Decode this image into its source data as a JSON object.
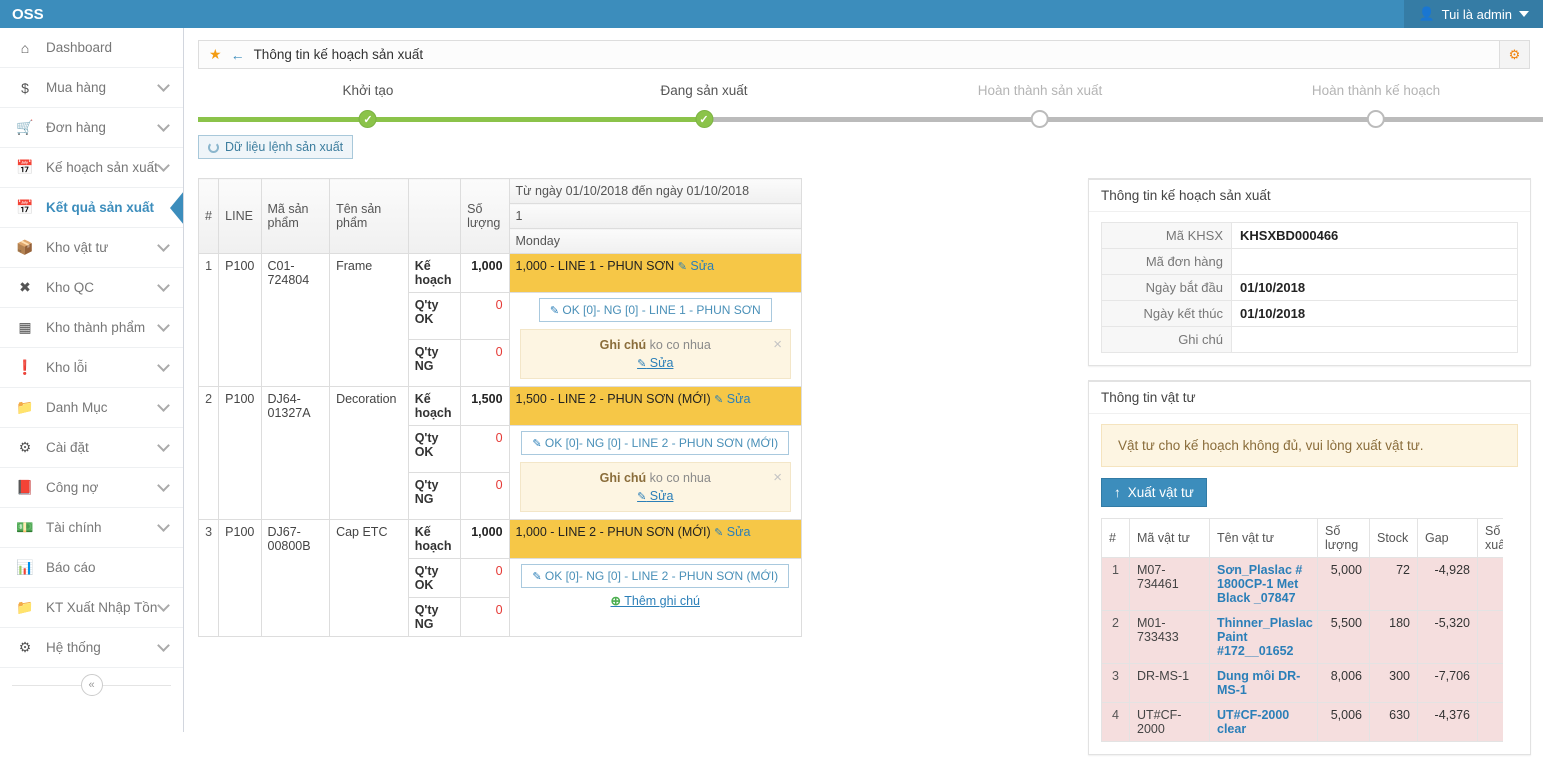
{
  "topbar": {
    "logo": "OSS",
    "user_label": "Tui là admin",
    "user_icon": "user-icon",
    "caret_icon": "caret-down-icon"
  },
  "sidebar": {
    "items": [
      {
        "label": "Dashboard",
        "icon": "home-icon",
        "caret": false,
        "active": false
      },
      {
        "label": "Mua hàng",
        "icon": "dollar-icon",
        "caret": true,
        "active": false
      },
      {
        "label": "Đơn hàng",
        "icon": "cart-icon",
        "caret": true,
        "active": false
      },
      {
        "label": "Kế hoạch sản xuất",
        "icon": "calendar-icon",
        "caret": true,
        "active": false
      },
      {
        "label": "Kết quả sản xuất",
        "icon": "calendar-icon",
        "caret": false,
        "active": true
      },
      {
        "label": "Kho vật tư",
        "icon": "box-icon",
        "caret": true,
        "active": false
      },
      {
        "label": "Kho QC",
        "icon": "qc-icon",
        "caret": true,
        "active": false
      },
      {
        "label": "Kho thành phẩm",
        "icon": "grid-icon",
        "caret": true,
        "active": false
      },
      {
        "label": "Kho lỗi",
        "icon": "exclamation-icon",
        "caret": true,
        "active": false
      },
      {
        "label": "Danh Mục",
        "icon": "folder-icon",
        "caret": true,
        "active": false
      },
      {
        "label": "Cài đặt",
        "icon": "gears-icon",
        "caret": true,
        "active": false
      },
      {
        "label": "Công nợ",
        "icon": "book-icon",
        "caret": true,
        "active": false
      },
      {
        "label": "Tài chính",
        "icon": "money-icon",
        "caret": true,
        "active": false
      },
      {
        "label": "Báo cáo",
        "icon": "bar-chart-icon",
        "caret": false,
        "active": false
      },
      {
        "label": "KT Xuất Nhập Tồn",
        "icon": "folder-icon",
        "caret": true,
        "active": false
      },
      {
        "label": "Hệ thống",
        "icon": "gear-icon",
        "caret": true,
        "active": false
      }
    ],
    "collapse_icon": "double-chevron-left-icon"
  },
  "page_header": {
    "star_icon": "star-icon",
    "back_icon": "arrow-left-icon",
    "title": "Thông tin kế hoạch sản xuất",
    "gear_icon": "gear-icon"
  },
  "stepper": {
    "steps": [
      {
        "label": "Khởi tạo",
        "state": "done"
      },
      {
        "label": "Đang sản xuất",
        "state": "done"
      },
      {
        "label": "Hoàn thành sản xuất",
        "state": "todo"
      },
      {
        "label": "Hoàn thành kế hoạch",
        "state": "todo"
      }
    ],
    "done_color": "#8bc34a",
    "todo_color": "#bbbbbb"
  },
  "subtoolbar": {
    "data_button": "Dữ liệu lệnh sản xuất",
    "data_button_icon": "circle-notch-icon"
  },
  "plan_table": {
    "headers": {
      "idx": "#",
      "line": "LINE",
      "product_code": "Mã sản phẩm",
      "product_name": "Tên sản phẩm",
      "kind": "",
      "qty": "Số lượng",
      "date_range": "Từ ngày 01/10/2018 đến ngày 01/10/2018",
      "day_number": "1",
      "day_name": "Monday"
    },
    "labels": {
      "ke_hoach": "Kế hoạch",
      "qty_ok": "Q'ty OK",
      "qty_ng": "Q'ty NG",
      "edit": "Sửa",
      "note_label": "Ghi chú",
      "add_note": "Thêm ghi chú",
      "close_icon": "close-icon",
      "pencil_icon": "pencil-icon",
      "plus_icon": "plus-circle-icon"
    },
    "rows": [
      {
        "idx": "1",
        "line": "P100",
        "product_code": "C01-724804",
        "product_name": "Frame",
        "plan_qty": "1,000",
        "ok_qty": "0",
        "ng_qty": "0",
        "plan_cell": "1,000 - LINE 1 - PHUN SƠN",
        "ok_button": "OK [0]- NG [0] - LINE 1 - PHUN SƠN",
        "note_text": "ko co nhua",
        "has_note": true
      },
      {
        "idx": "2",
        "line": "P100",
        "product_code": "DJ64-01327A",
        "product_name": "Decoration",
        "plan_qty": "1,500",
        "ok_qty": "0",
        "ng_qty": "0",
        "plan_cell": "1,500 - LINE 2 - PHUN SƠN (MỚI)",
        "ok_button": "OK [0]- NG [0] - LINE 2 - PHUN SƠN (MỚI)",
        "note_text": "ko co nhua",
        "has_note": true
      },
      {
        "idx": "3",
        "line": "P100",
        "product_code": "DJ67-00800B",
        "product_name": "Cap ETC",
        "plan_qty": "1,000",
        "ok_qty": "0",
        "ng_qty": "0",
        "plan_cell": "1,000 - LINE 2 - PHUN SƠN (MỚI)",
        "ok_button": "OK [0]- NG [0] - LINE 2 - PHUN SƠN (MỚI)",
        "note_text": "",
        "has_note": false
      }
    ]
  },
  "plan_info_panel": {
    "title": "Thông tin kế hoạch sản xuất",
    "fields": [
      {
        "key": "Mã KHSX",
        "value": "KHSXBD000466"
      },
      {
        "key": "Mã đơn hàng",
        "value": ""
      },
      {
        "key": "Ngày bắt đầu",
        "value": "01/10/2018"
      },
      {
        "key": "Ngày kết thúc",
        "value": "01/10/2018"
      },
      {
        "key": "Ghi chú",
        "value": ""
      }
    ]
  },
  "material_panel": {
    "title": "Thông tin vật tư",
    "alert": "Vật tư cho kế hoạch không đủ, vui lòng xuất vật tư.",
    "export_button": "Xuất vật tư",
    "export_button_icon": "upload-arrow-icon",
    "headers": {
      "idx": "#",
      "code": "Mã vật tư",
      "name": "Tên vật tư",
      "qty": "Số lượng",
      "stock": "Stock",
      "gap": "Gap",
      "extra": "Số lượng xuất"
    },
    "rows": [
      {
        "idx": "1",
        "code": "M07-734461",
        "name": "Sơn_Plaslac # 1800CP-1 Met Black _07847",
        "qty": "5,000",
        "stock": "72",
        "gap": "-4,928",
        "extra": ""
      },
      {
        "idx": "2",
        "code": "M01-733433",
        "name": "Thinner_Plaslac Paint #172__01652",
        "qty": "5,500",
        "stock": "180",
        "gap": "-5,320",
        "extra": ""
      },
      {
        "idx": "3",
        "code": "DR-MS-1",
        "name": "Dung môi DR-MS-1",
        "qty": "8,006",
        "stock": "300",
        "gap": "-7,706",
        "extra": ""
      },
      {
        "idx": "4",
        "code": "UT#CF-2000",
        "name": "UT#CF-2000 clear",
        "qty": "5,006",
        "stock": "630",
        "gap": "-4,376",
        "extra": ""
      }
    ]
  },
  "colors": {
    "brand": "#3c8dbc",
    "plan_cell": "#f6c747",
    "note_bg": "#fdf5e2",
    "danger_row": "#f5dede",
    "link": "#2b7fb8",
    "zero": "#e53935"
  }
}
